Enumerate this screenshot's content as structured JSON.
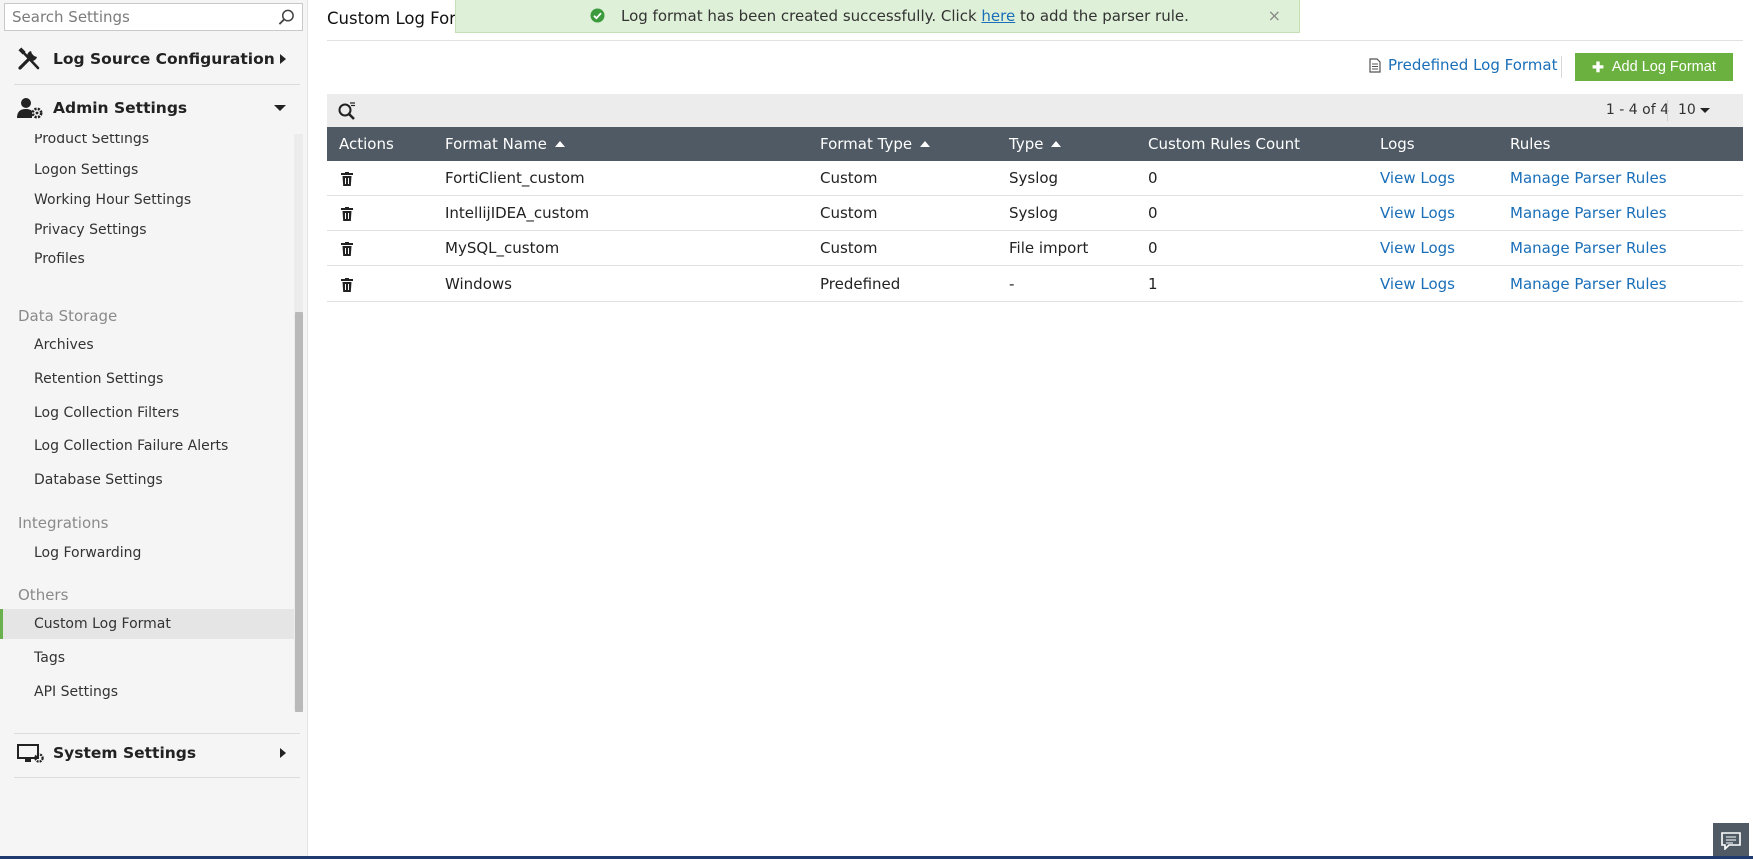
{
  "sidebar": {
    "search_placeholder": "Search Settings",
    "sections": {
      "log_source": "Log Source Configuration",
      "admin": "Admin Settings",
      "system": "System Settings"
    },
    "admin_items": [
      "Product Settings",
      "Logon Settings",
      "Working Hour Settings",
      "Privacy Settings",
      "Profiles"
    ],
    "groups": {
      "data_storage": "Data Storage",
      "integrations": "Integrations",
      "others": "Others"
    },
    "data_storage_items": [
      "Archives",
      "Retention Settings",
      "Log Collection Filters",
      "Log Collection Failure Alerts",
      "Database Settings"
    ],
    "integration_items": [
      "Log Forwarding"
    ],
    "other_items": [
      "Custom Log Format",
      "Tags",
      "API Settings"
    ],
    "active_item": "Custom Log Format"
  },
  "main": {
    "title": "Custom Log Forr",
    "toast": {
      "text_before": "Log format has been created successfully. Click ",
      "link": "here",
      "text_after": " to add the parser rule.",
      "close": "×"
    },
    "predefined_link": "Predefined Log Format",
    "add_button": "Add Log Format",
    "pager": "1 - 4 of 4",
    "per_page": "10",
    "columns": [
      "Actions",
      "Format Name",
      "Format Type",
      "Type",
      "Custom Rules Count",
      "Logs",
      "Rules"
    ],
    "rows": [
      {
        "name": "FortiClient_custom",
        "format_type": "Custom",
        "type": "Syslog",
        "count": "0",
        "logs": "View Logs",
        "rules": "Manage Parser Rules"
      },
      {
        "name": "IntellijIDEA_custom",
        "format_type": "Custom",
        "type": "Syslog",
        "count": "0",
        "logs": "View Logs",
        "rules": "Manage Parser Rules"
      },
      {
        "name": "MySQL_custom",
        "format_type": "Custom",
        "type": "File import",
        "count": "0",
        "logs": "View Logs",
        "rules": "Manage Parser Rules"
      },
      {
        "name": "Windows",
        "format_type": "Predefined",
        "type": "-",
        "count": "1",
        "logs": "View Logs",
        "rules": "Manage Parser Rules"
      }
    ]
  },
  "colors": {
    "accent_green": "#6bb13f",
    "header_dark": "#4f5a64",
    "link_blue": "#1a6fb8",
    "toast_bg": "#dff0d8"
  }
}
